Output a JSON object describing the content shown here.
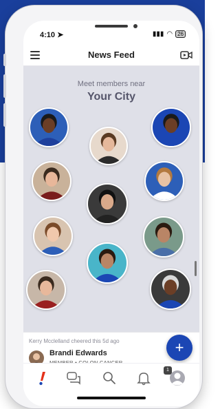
{
  "status_bar": {
    "time": "4:10",
    "battery": "26"
  },
  "header": {
    "title": "News Feed",
    "menu_icon": "hamburger-menu-icon",
    "video_icon": "video-camera-icon"
  },
  "feed": {
    "meet_text": "Meet members near",
    "city": "Your City",
    "members": [
      {
        "name": "member-1",
        "colors": {
          "bg": "#2d5fb8",
          "skin": "#6b3e26",
          "shirt": "#1e3f9c",
          "hair": "#1a1a1a"
        }
      },
      {
        "name": "member-2",
        "colors": {
          "bg": "#e7d9cc",
          "skin": "#e5b89b",
          "shirt": "#2b2b2b",
          "hair": "#5a3a22"
        }
      },
      {
        "name": "member-3",
        "colors": {
          "bg": "#1b46b4",
          "skin": "#6b3e26",
          "shirt": "#1b46b4",
          "hair": "#1a1a1a"
        }
      },
      {
        "name": "member-4",
        "colors": {
          "bg": "#c9b29a",
          "skin": "#e8b79a",
          "shirt": "#7a1d1d",
          "hair": "#3a2a1e"
        }
      },
      {
        "name": "member-5",
        "colors": {
          "bg": "#2d5fb8",
          "skin": "#e8c2a4",
          "shirt": "#ffffff",
          "hair": "#b3793f"
        }
      },
      {
        "name": "member-6",
        "colors": {
          "bg": "#3a3a3a",
          "skin": "#d9a98a",
          "shirt": "#222222",
          "hair": "#111111"
        }
      },
      {
        "name": "member-7",
        "colors": {
          "bg": "#d8c4b0",
          "skin": "#f0c8ac",
          "shirt": "#2d5fb8",
          "hair": "#7a4b2a"
        }
      },
      {
        "name": "member-8",
        "colors": {
          "bg": "#7a9a8a",
          "skin": "#b98566",
          "shirt": "#4a6fa8",
          "hair": "#2a1a10"
        }
      },
      {
        "name": "member-9",
        "colors": {
          "bg": "#49b5c9",
          "skin": "#b98566",
          "shirt": "#1b46b4",
          "hair": "#2a1a10"
        }
      },
      {
        "name": "member-10",
        "colors": {
          "bg": "#c7b7a8",
          "skin": "#e8b89b",
          "shirt": "#9a2020",
          "hair": "#3a2a1e"
        }
      },
      {
        "name": "member-11",
        "colors": {
          "bg": "#3a3a3a",
          "skin": "#6b3e26",
          "shirt": "#1b46b4",
          "hair": "#d9d9d9"
        }
      }
    ]
  },
  "activity": {
    "meta": "Kerry Mcclelland cheered this 5d ago",
    "name": "Brandi Edwards",
    "tags": "MEMBER • COLON CANCER"
  },
  "fab": {
    "label": "+",
    "icon": "plus-icon"
  },
  "tab_bar": {
    "items": [
      {
        "icon": "exclamation-logo-icon"
      },
      {
        "icon": "chat-bubbles-icon"
      },
      {
        "icon": "search-icon"
      },
      {
        "icon": "bell-icon"
      },
      {
        "icon": "profile-icon"
      }
    ],
    "notification_count": "1"
  },
  "colors": {
    "brand_blue": "#1b46b4",
    "feed_background": "#dfe0e8",
    "accent_red": "#e4321b"
  }
}
